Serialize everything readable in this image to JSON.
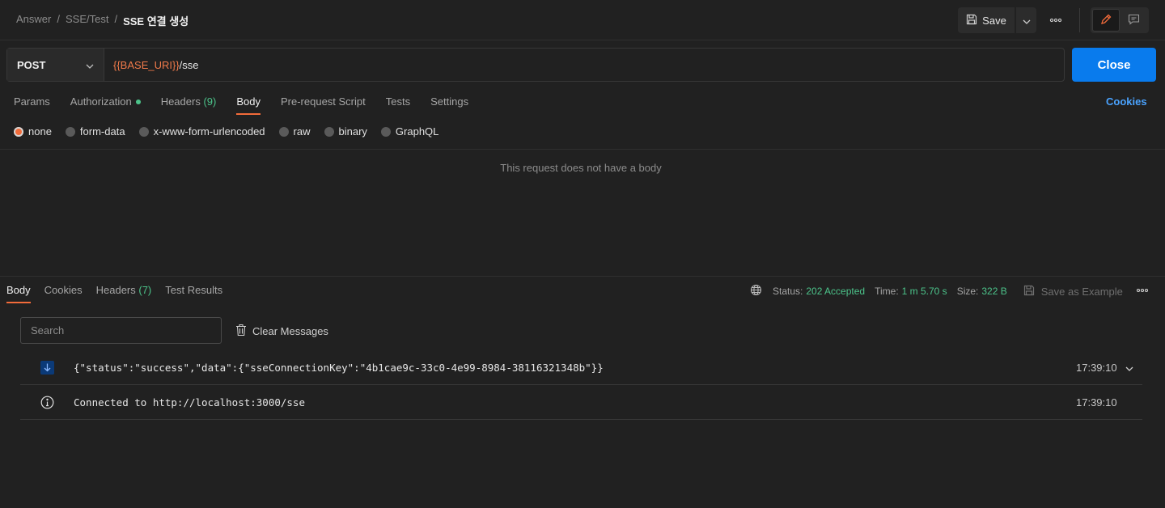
{
  "breadcrumb": {
    "items": [
      "Answer",
      "SSE/Test"
    ],
    "current": "SSE 연결 생성",
    "separator": "/"
  },
  "toolbar": {
    "save_label": "Save",
    "save_icon": "floppy-disk-icon",
    "more_icon": "more-horizontal-icon",
    "edit_icon": "pencil-icon",
    "comment_icon": "comment-icon"
  },
  "request": {
    "method": "POST",
    "url_variable": "{{BASE_URI}}",
    "url_path": "/sse",
    "action_button": "Close"
  },
  "request_tabs": [
    {
      "label": "Params"
    },
    {
      "label": "Authorization",
      "indicator": "green-dot"
    },
    {
      "label": "Headers",
      "count": "(9)"
    },
    {
      "label": "Body",
      "active": true
    },
    {
      "label": "Pre-request Script"
    },
    {
      "label": "Tests"
    },
    {
      "label": "Settings"
    }
  ],
  "cookies_link": "Cookies",
  "body_types": {
    "options": [
      "none",
      "form-data",
      "x-www-form-urlencoded",
      "raw",
      "binary",
      "GraphQL"
    ],
    "selected": "none"
  },
  "body_empty_message": "This request does not have a body",
  "response_tabs": [
    {
      "label": "Body",
      "active": true
    },
    {
      "label": "Cookies"
    },
    {
      "label": "Headers",
      "count": "(7)"
    },
    {
      "label": "Test Results"
    }
  ],
  "response_meta": {
    "status_label": "Status:",
    "status_value": "202 Accepted",
    "time_label": "Time:",
    "time_value": "1 m 5.70 s",
    "size_label": "Size:",
    "size_value": "322 B",
    "save_example_label": "Save as Example"
  },
  "messages_toolbar": {
    "search_placeholder": "Search",
    "clear_label": "Clear Messages"
  },
  "messages": [
    {
      "icon": "arrow-down-icon",
      "text": "{\"status\":\"success\",\"data\":{\"sseConnectionKey\":\"4b1cae9c-33c0-4e99-8984-38116321348b\"}}",
      "time": "17:39:10",
      "expandable": true
    },
    {
      "icon": "info-icon",
      "text": "Connected to http://localhost:3000/sse",
      "time": "17:39:10",
      "expandable": false
    }
  ],
  "colors": {
    "accent": "#f26b3a",
    "primary_button": "#097bed",
    "success": "#4cc38a",
    "link": "#4aa3ff",
    "url_variable": "#f07a4a"
  }
}
